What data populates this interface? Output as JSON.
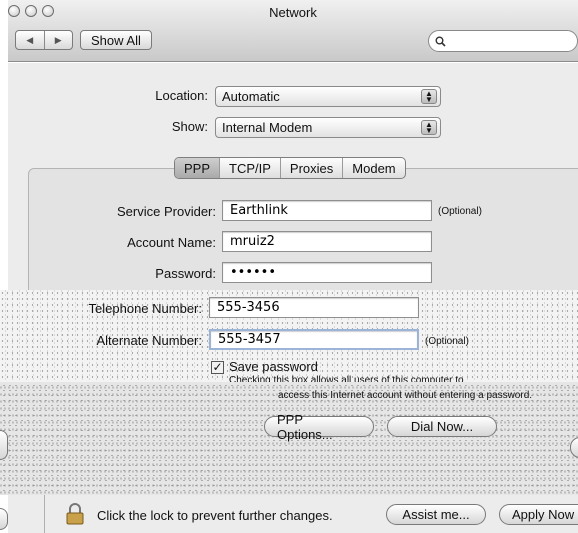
{
  "window": {
    "title": "Network"
  },
  "toolbar": {
    "back_label": "◀",
    "forward_label": "▶",
    "show_all_label": "Show All",
    "search": {
      "value": "",
      "placeholder": ""
    }
  },
  "location": {
    "label": "Location:",
    "value": "Automatic"
  },
  "show": {
    "label": "Show:",
    "value": "Internal Modem"
  },
  "tabs": [
    {
      "label": "PPP",
      "selected": true
    },
    {
      "label": "TCP/IP",
      "selected": false
    },
    {
      "label": "Proxies",
      "selected": false
    },
    {
      "label": "Modem",
      "selected": false
    }
  ],
  "form": {
    "service_provider": {
      "label": "Service Provider:",
      "value": "Earthlink",
      "note": "(Optional)"
    },
    "account_name": {
      "label": "Account Name:",
      "value": "mruiz2"
    },
    "password": {
      "label": "Password:",
      "value": "••••••"
    },
    "telephone": {
      "label": "Telephone Number:",
      "value": "555-3456"
    },
    "alternate": {
      "label": "Alternate Number:",
      "value": "555-3457",
      "note": "(Optional)"
    },
    "save_password": {
      "label": "Save password",
      "checked": true
    },
    "help_line1": "Checking this box allows all users of this computer to",
    "help_line2": "access this Internet account without entering a password."
  },
  "buttons": {
    "ppp_options": "PPP Options...",
    "dial_now": "Dial Now..."
  },
  "footer": {
    "lock_text": "Click the lock to prevent further changes.",
    "assist_label": "Assist me...",
    "apply_label": "Apply Now"
  }
}
